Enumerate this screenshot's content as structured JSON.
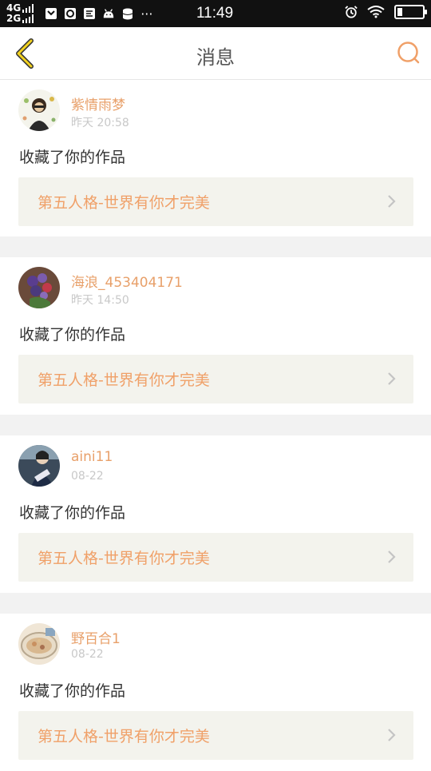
{
  "status_bar": {
    "network_top": "4G",
    "network_bottom": "2G",
    "time": "11:49",
    "more": "···"
  },
  "header": {
    "title": "消息",
    "back_icon": "chevron-left-icon",
    "search_icon": "search-icon",
    "accent_color": "#e8a06a"
  },
  "messages": [
    {
      "username": "紫情雨梦",
      "time": "昨天 20:58",
      "action": "收藏了你的作品",
      "work_title": "第五人格-世界有你才完美"
    },
    {
      "username": "海浪_453404171",
      "time": "昨天 14:50",
      "action": "收藏了你的作品",
      "work_title": "第五人格-世界有你才完美"
    },
    {
      "username": "aini11",
      "time": "08-22",
      "action": "收藏了你的作品",
      "work_title": "第五人格-世界有你才完美"
    },
    {
      "username": "野百合1",
      "time": "08-22",
      "action": "收藏了你的作品",
      "work_title": "第五人格-世界有你才完美"
    }
  ]
}
